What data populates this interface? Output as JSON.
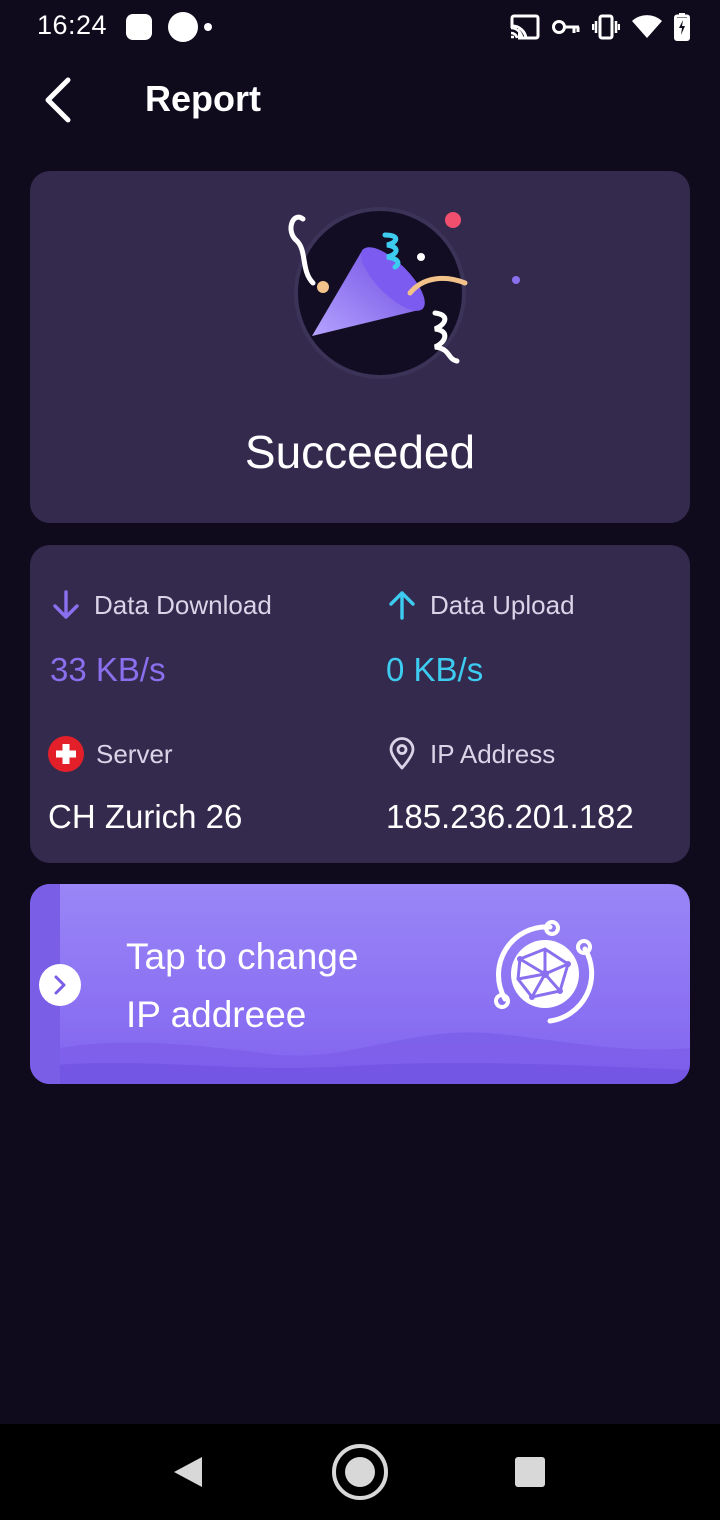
{
  "status_bar": {
    "time": "16:24"
  },
  "header": {
    "title": "Report",
    "back_icon": "chevron-left-icon"
  },
  "success_card": {
    "message": "Succeeded",
    "illustration_icon": "party-popper-icon"
  },
  "stats": {
    "download": {
      "label": "Data Download",
      "value": "33 KB/s",
      "icon": "arrow-down-icon",
      "color": "#8a70ee"
    },
    "upload": {
      "label": "Data Upload",
      "value": "0 KB/s",
      "icon": "arrow-up-icon",
      "color": "#3dcbf0"
    },
    "server": {
      "label": "Server",
      "value": "CH Zurich 26",
      "icon": "swiss-flag-icon"
    },
    "ip": {
      "label": "IP Address",
      "value": "185.236.201.182",
      "icon": "location-pin-icon"
    }
  },
  "banner": {
    "line1": "Tap to change",
    "line2": "IP addreee",
    "icon": "globe-network-icon"
  },
  "colors": {
    "background": "#0f0b1d",
    "card": "#342a4d",
    "accent_purple": "#8a70ee",
    "accent_cyan": "#3dcbf0"
  }
}
